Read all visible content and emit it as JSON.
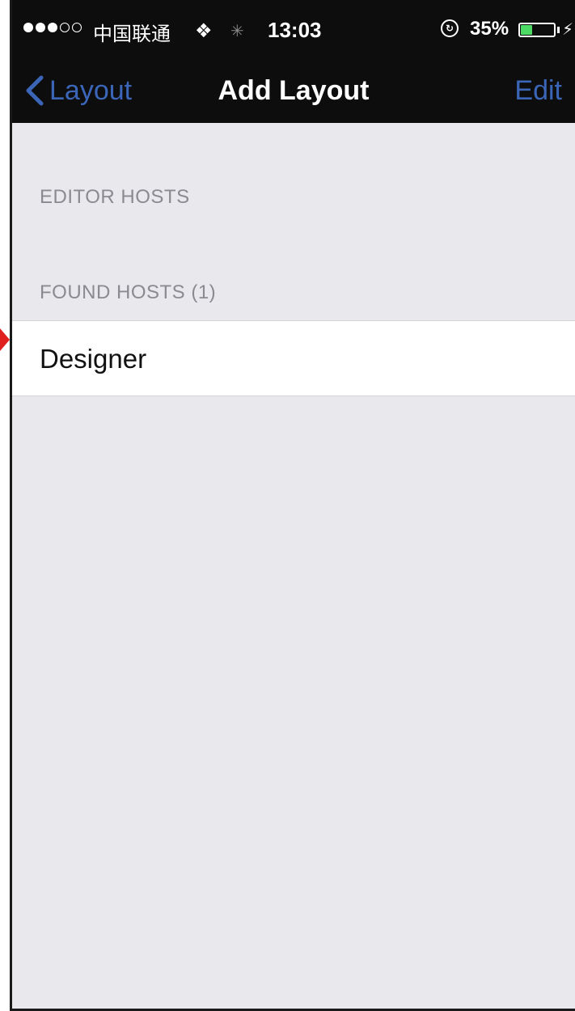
{
  "status_bar": {
    "carrier": "中国联通",
    "time": "13:03",
    "battery_percent": "35%",
    "battery_level": 0.35,
    "signal_strength": 3,
    "signal_total": 5
  },
  "nav_bar": {
    "back_label": "Layout",
    "title": "Add Layout",
    "edit_label": "Edit"
  },
  "sections": {
    "editor_hosts": {
      "header": "EDITOR HOSTS"
    },
    "found_hosts": {
      "header": "FOUND HOSTS (1)",
      "items": [
        {
          "label": "Designer"
        }
      ]
    }
  },
  "colors": {
    "accent": "#3b66b8",
    "nav_background": "#0d0d0d",
    "background": "#e8e8ed",
    "section_header": "#8a8a90",
    "battery_fill": "#4cd964",
    "annotation": "#e0201e"
  }
}
